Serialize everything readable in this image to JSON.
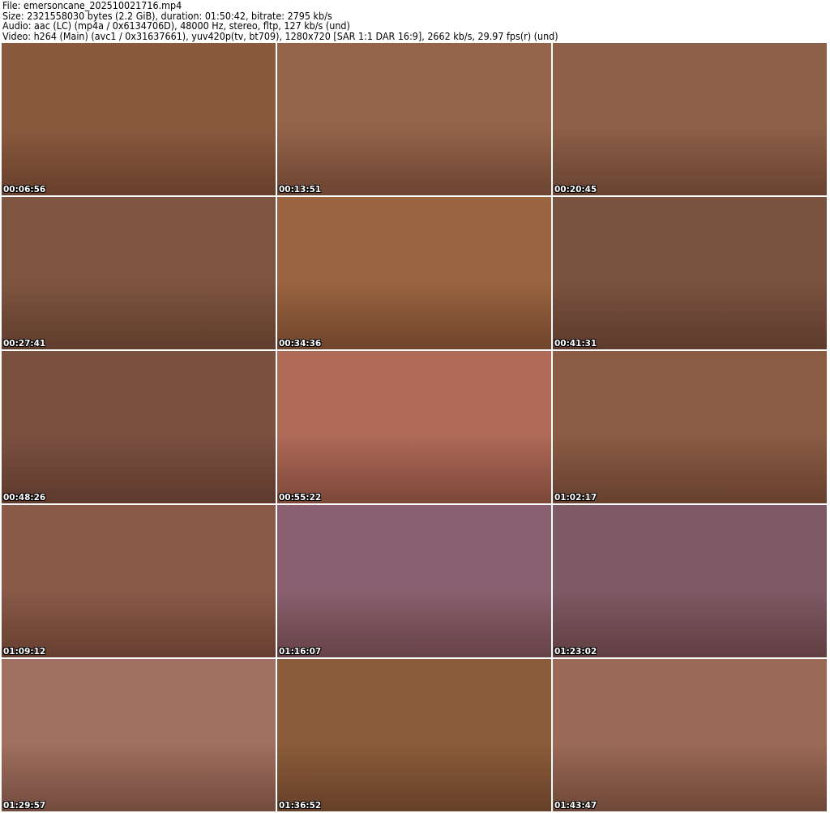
{
  "header": {
    "file": "File: emersoncane_202510021716.mp4",
    "size": "Size: 2321558030 bytes (2.2 GiB), duration: 01:50:42, bitrate: 2795 kb/s",
    "audio": "Audio: aac (LC) (mp4a / 0x6134706D), 48000 Hz, stereo, fltp, 127 kb/s (und)",
    "video": "Video: h264 (Main) (avc1 / 0x31637661), yuv420p(tv, bt709), 1280x720 [SAR 1:1 DAR 16:9], 2662 kb/s, 29.97 fps(r) (und)"
  },
  "thumbnails": [
    {
      "time": "00:06:56",
      "color": "#8a5a3e"
    },
    {
      "time": "00:13:51",
      "color": "#94644a"
    },
    {
      "time": "00:20:45",
      "color": "#8d6048"
    },
    {
      "time": "00:27:41",
      "color": "#7e5540"
    },
    {
      "time": "00:34:36",
      "color": "#9a6440"
    },
    {
      "time": "00:41:31",
      "color": "#7a5240"
    },
    {
      "time": "00:48:26",
      "color": "#7a5040"
    },
    {
      "time": "00:55:22",
      "color": "#b06a58"
    },
    {
      "time": "01:02:17",
      "color": "#8a5c44"
    },
    {
      "time": "01:09:12",
      "color": "#8a5a48"
    },
    {
      "time": "01:16:07",
      "color": "#8a6070"
    },
    {
      "time": "01:23:02",
      "color": "#7e5a66"
    },
    {
      "time": "01:29:57",
      "color": "#a07060"
    },
    {
      "time": "01:36:52",
      "color": "#8a5c3a"
    },
    {
      "time": "01:43:47",
      "color": "#9a6a56"
    }
  ]
}
